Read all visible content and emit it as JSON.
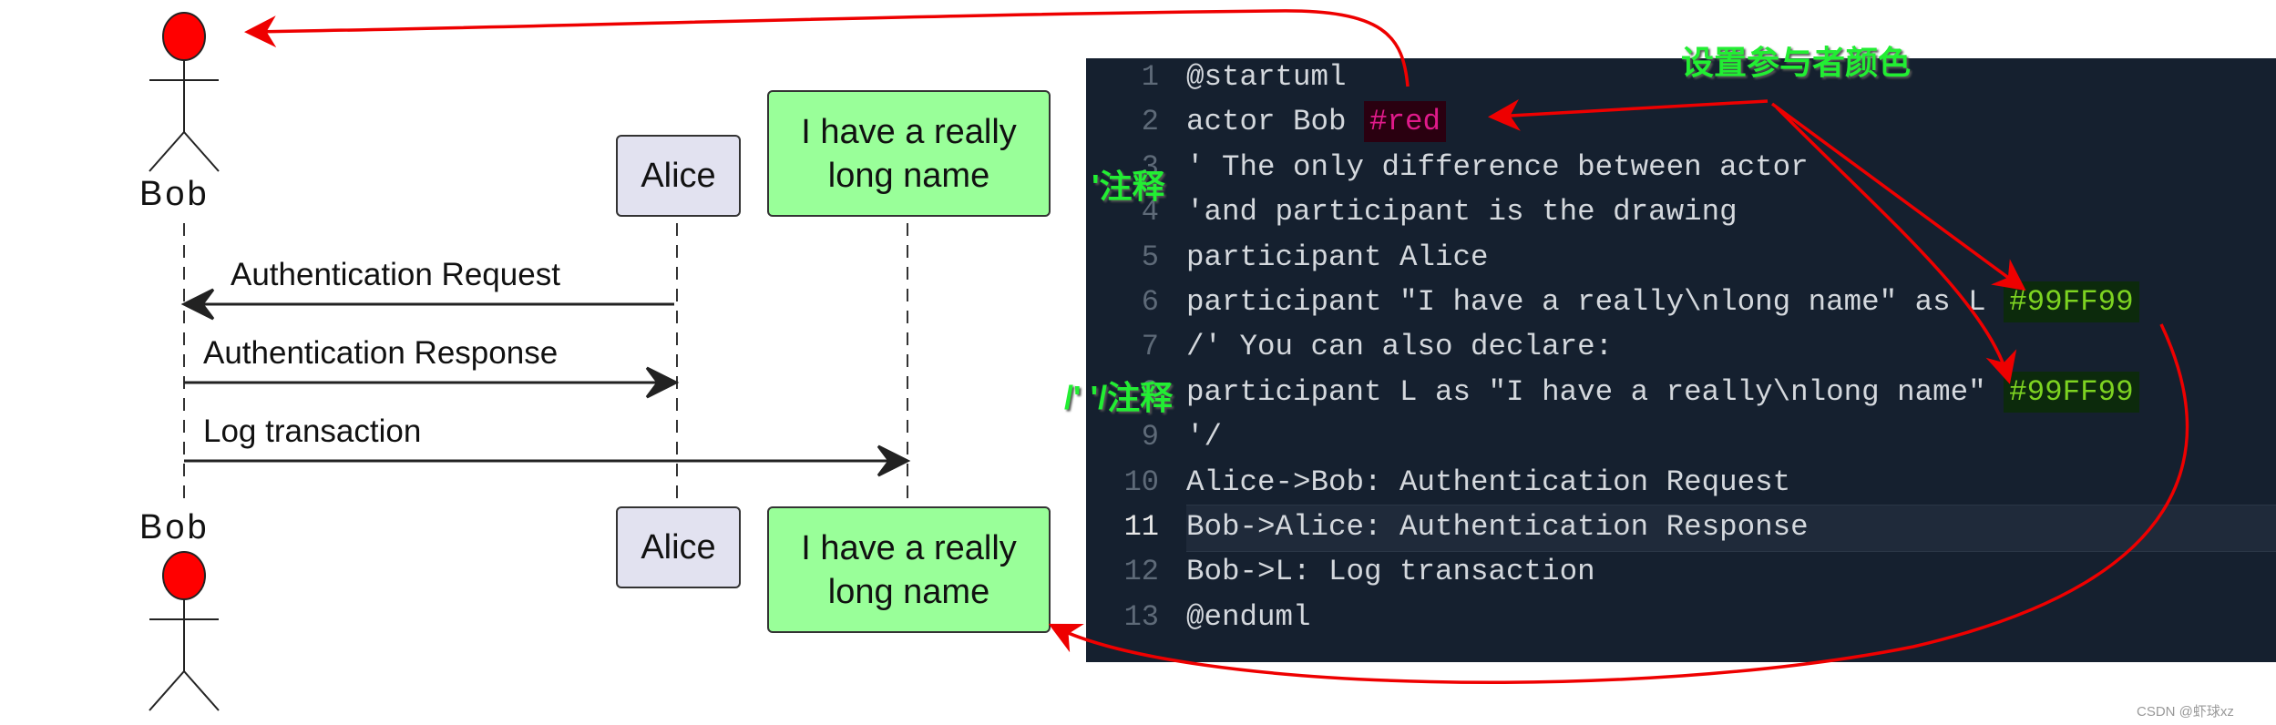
{
  "diagram": {
    "actor_top": "Bob",
    "actor_bottom": "Bob",
    "alice_top": "Alice",
    "alice_bottom": "Alice",
    "long_top": "I have a really\nlong name",
    "long_bottom": "I have a really\nlong name",
    "messages": [
      "Authentication Request",
      "Authentication Response",
      "Log transaction"
    ],
    "colors": {
      "actor": "#FF0000",
      "alice": "#E2E2F0",
      "long": "#99FF99"
    }
  },
  "code": {
    "lines": [
      {
        "n": "1",
        "pre": "@startuml"
      },
      {
        "n": "2",
        "pre": "actor Bob ",
        "chip": "#red",
        "chip_type": "red"
      },
      {
        "n": "3",
        "pre": "' The only difference between actor"
      },
      {
        "n": "4",
        "pre": "'and participant is the drawing"
      },
      {
        "n": "5",
        "pre": "participant Alice"
      },
      {
        "n": "6",
        "pre": "participant \"I have a really\\nlong name\" as L ",
        "chip": "#99FF99",
        "chip_type": "green"
      },
      {
        "n": "7",
        "pre": "/' You can also declare:"
      },
      {
        "n": "8",
        "pre": "participant L as \"I have a really\\nlong name\" ",
        "chip": "#99FF99",
        "chip_type": "green"
      },
      {
        "n": "9",
        "pre": "'/"
      },
      {
        "n": "10",
        "pre": "Alice->Bob: Authentication Request"
      },
      {
        "n": "11",
        "pre": "Bob->Alice: Authentication Response"
      },
      {
        "n": "12",
        "pre": "Bob->L: Log transaction"
      },
      {
        "n": "13",
        "pre": "@enduml"
      }
    ],
    "current_line": "11"
  },
  "annotations": {
    "set_color": "设置参与者颜色",
    "comment1": "'注释",
    "comment2": "/' '/注释"
  },
  "watermark": "CSDN @虾球xz"
}
